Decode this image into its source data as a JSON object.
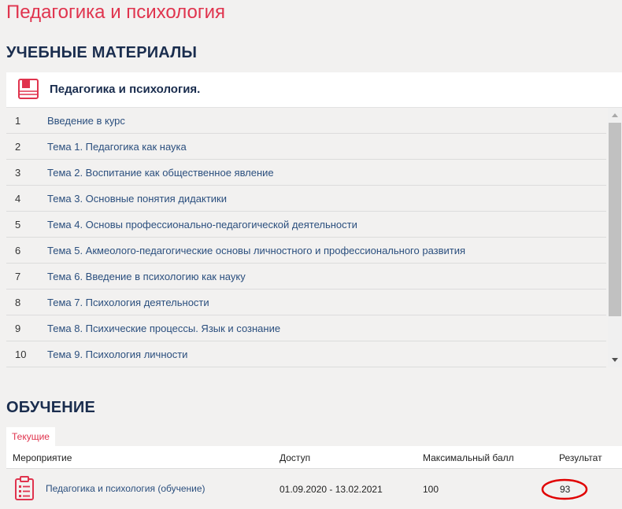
{
  "page_title": "Педагогика и психология",
  "materials": {
    "section_title": "УЧЕБНЫЕ МАТЕРИАЛЫ",
    "course_name": "Педагогика и психология.",
    "topics": [
      {
        "num": "1",
        "title": "Введение в курс"
      },
      {
        "num": "2",
        "title": "Тема 1. Педагогика как наука"
      },
      {
        "num": "3",
        "title": "Тема 2. Воспитание как общественное явление"
      },
      {
        "num": "4",
        "title": "Тема 3. Основные понятия дидактики"
      },
      {
        "num": "5",
        "title": "Тема 4. Основы профессионально-педагогической деятельности"
      },
      {
        "num": "6",
        "title": "Тема 5. Акмеолого-педагогические основы личностного и профессионального развития"
      },
      {
        "num": "7",
        "title": "Тема 6. Введение в психологию как науку"
      },
      {
        "num": "8",
        "title": "Тема 7. Психология деятельности"
      },
      {
        "num": "9",
        "title": "Тема 8. Психические процессы. Язык и сознание"
      },
      {
        "num": "10",
        "title": "Тема 9. Психология личности"
      }
    ]
  },
  "learning": {
    "section_title": "ОБУЧЕНИЕ",
    "tab_current": "Текущие",
    "columns": {
      "event": "Мероприятие",
      "access": "Доступ",
      "max_score": "Максимальный балл",
      "result": "Результат"
    },
    "rows": [
      {
        "event": "Педагогика и психология (обучение)",
        "access": "01.09.2020 - 13.02.2021",
        "max_score": "100",
        "result": "93"
      }
    ]
  },
  "icons": {
    "course": "book-icon",
    "event": "clipboard-list-icon",
    "scroll_up": "chevron-up-icon",
    "scroll_down": "chevron-down-icon"
  },
  "colors": {
    "accent": "#e0344e",
    "heading": "#1a2d4e",
    "link": "#2b4f7e",
    "background": "#f2f1f0",
    "highlight_circle": "#e00000"
  }
}
